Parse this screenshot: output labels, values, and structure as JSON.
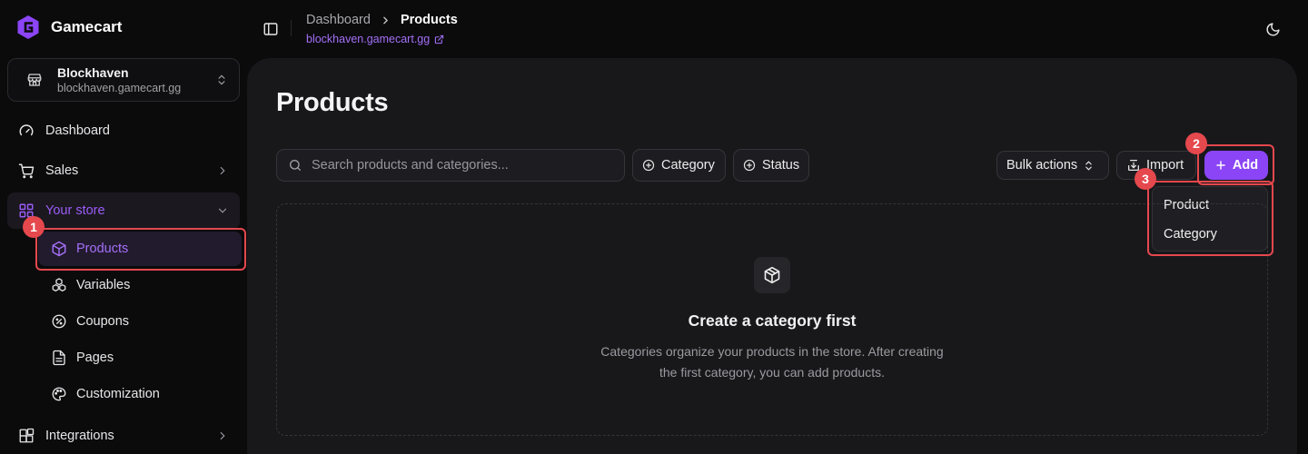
{
  "brand": {
    "name": "Gamecart"
  },
  "store": {
    "name": "Blockhaven",
    "url": "blockhaven.gamecart.gg"
  },
  "sidebar": {
    "items": [
      {
        "label": "Dashboard",
        "icon": "gauge-icon"
      },
      {
        "label": "Sales",
        "icon": "cart-icon"
      },
      {
        "label": "Your store",
        "icon": "grid-icon"
      },
      {
        "label": "Integrations",
        "icon": "puzzle-icon"
      }
    ],
    "store_sub": [
      {
        "label": "Products",
        "icon": "box-icon"
      },
      {
        "label": "Variables",
        "icon": "cubes-icon"
      },
      {
        "label": "Coupons",
        "icon": "percent-badge-icon"
      },
      {
        "label": "Pages",
        "icon": "file-icon"
      },
      {
        "label": "Customization",
        "icon": "palette-icon"
      }
    ]
  },
  "header": {
    "breadcrumb": [
      "Dashboard",
      "Products"
    ],
    "store_link": "blockhaven.gamecart.gg"
  },
  "main": {
    "title": "Products",
    "search_placeholder": "Search products and categories...",
    "filters": [
      "Category",
      "Status"
    ],
    "bulk_actions": "Bulk actions",
    "import": "Import",
    "add": "Add",
    "add_menu": [
      "Product",
      "Category"
    ],
    "empty": {
      "title": "Create a category first",
      "description": "Categories organize your products in the store. After creating the first category, you can add products."
    }
  },
  "annotations": [
    "1",
    "2",
    "3"
  ],
  "colors": {
    "accent": "#8b45f6",
    "highlight": "#e5484d"
  }
}
